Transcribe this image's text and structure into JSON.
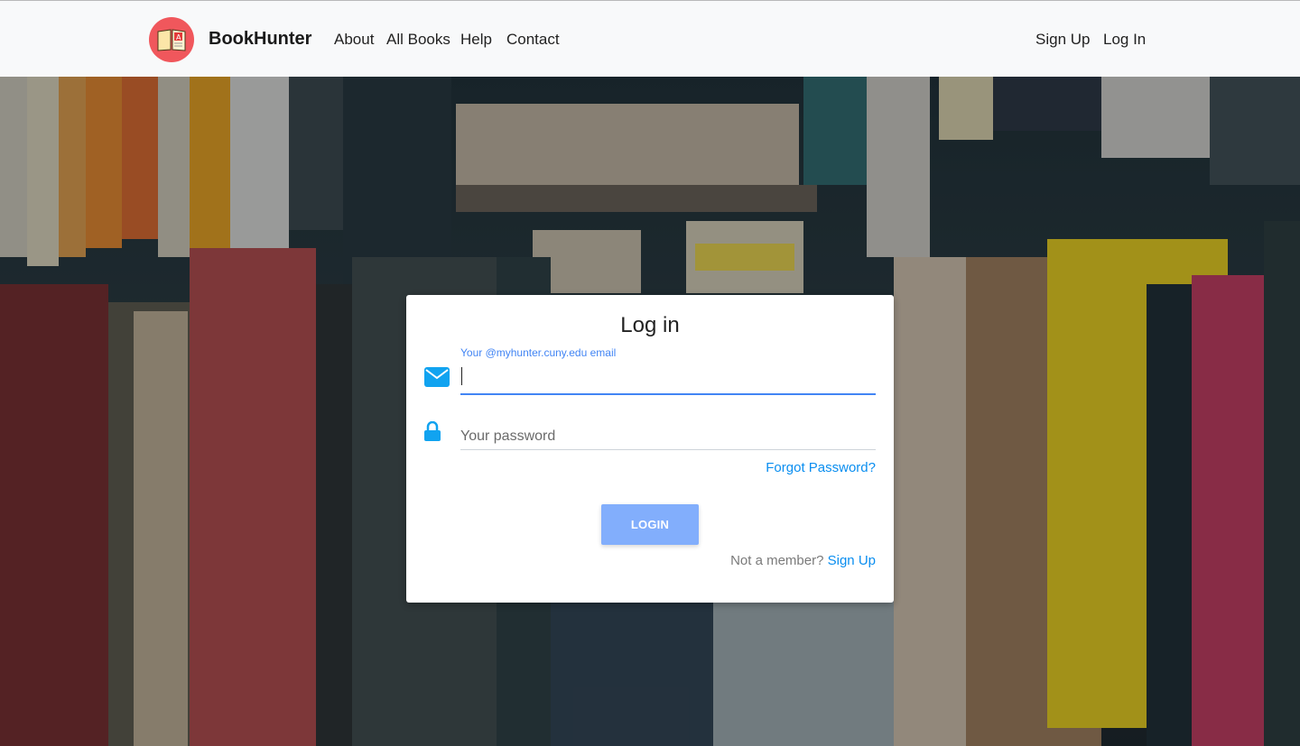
{
  "navbar": {
    "brand": "BookHunter",
    "links": [
      "About",
      "All Books",
      "Help",
      "Contact"
    ],
    "right_links": [
      "Sign Up",
      "Log In"
    ]
  },
  "login": {
    "title": "Log in",
    "email_label": "Your @myhunter.cuny.edu email",
    "email_value": "",
    "password_placeholder": "Your password",
    "forgot_link": "Forgot Password?",
    "submit_label": "LOGIN",
    "member_text": "Not a member?",
    "signup_link": "Sign Up"
  },
  "icons": {
    "brand": "book-logo-icon",
    "email": "envelope-icon",
    "password": "lock-icon"
  },
  "colors": {
    "brand_red": "#f0575c",
    "accent_blue": "#4285f4",
    "link_blue": "#0a8ef0",
    "icon_blue": "#11a3f0",
    "button_blue": "#82aefc",
    "navbar_bg": "#f8f9fa"
  }
}
